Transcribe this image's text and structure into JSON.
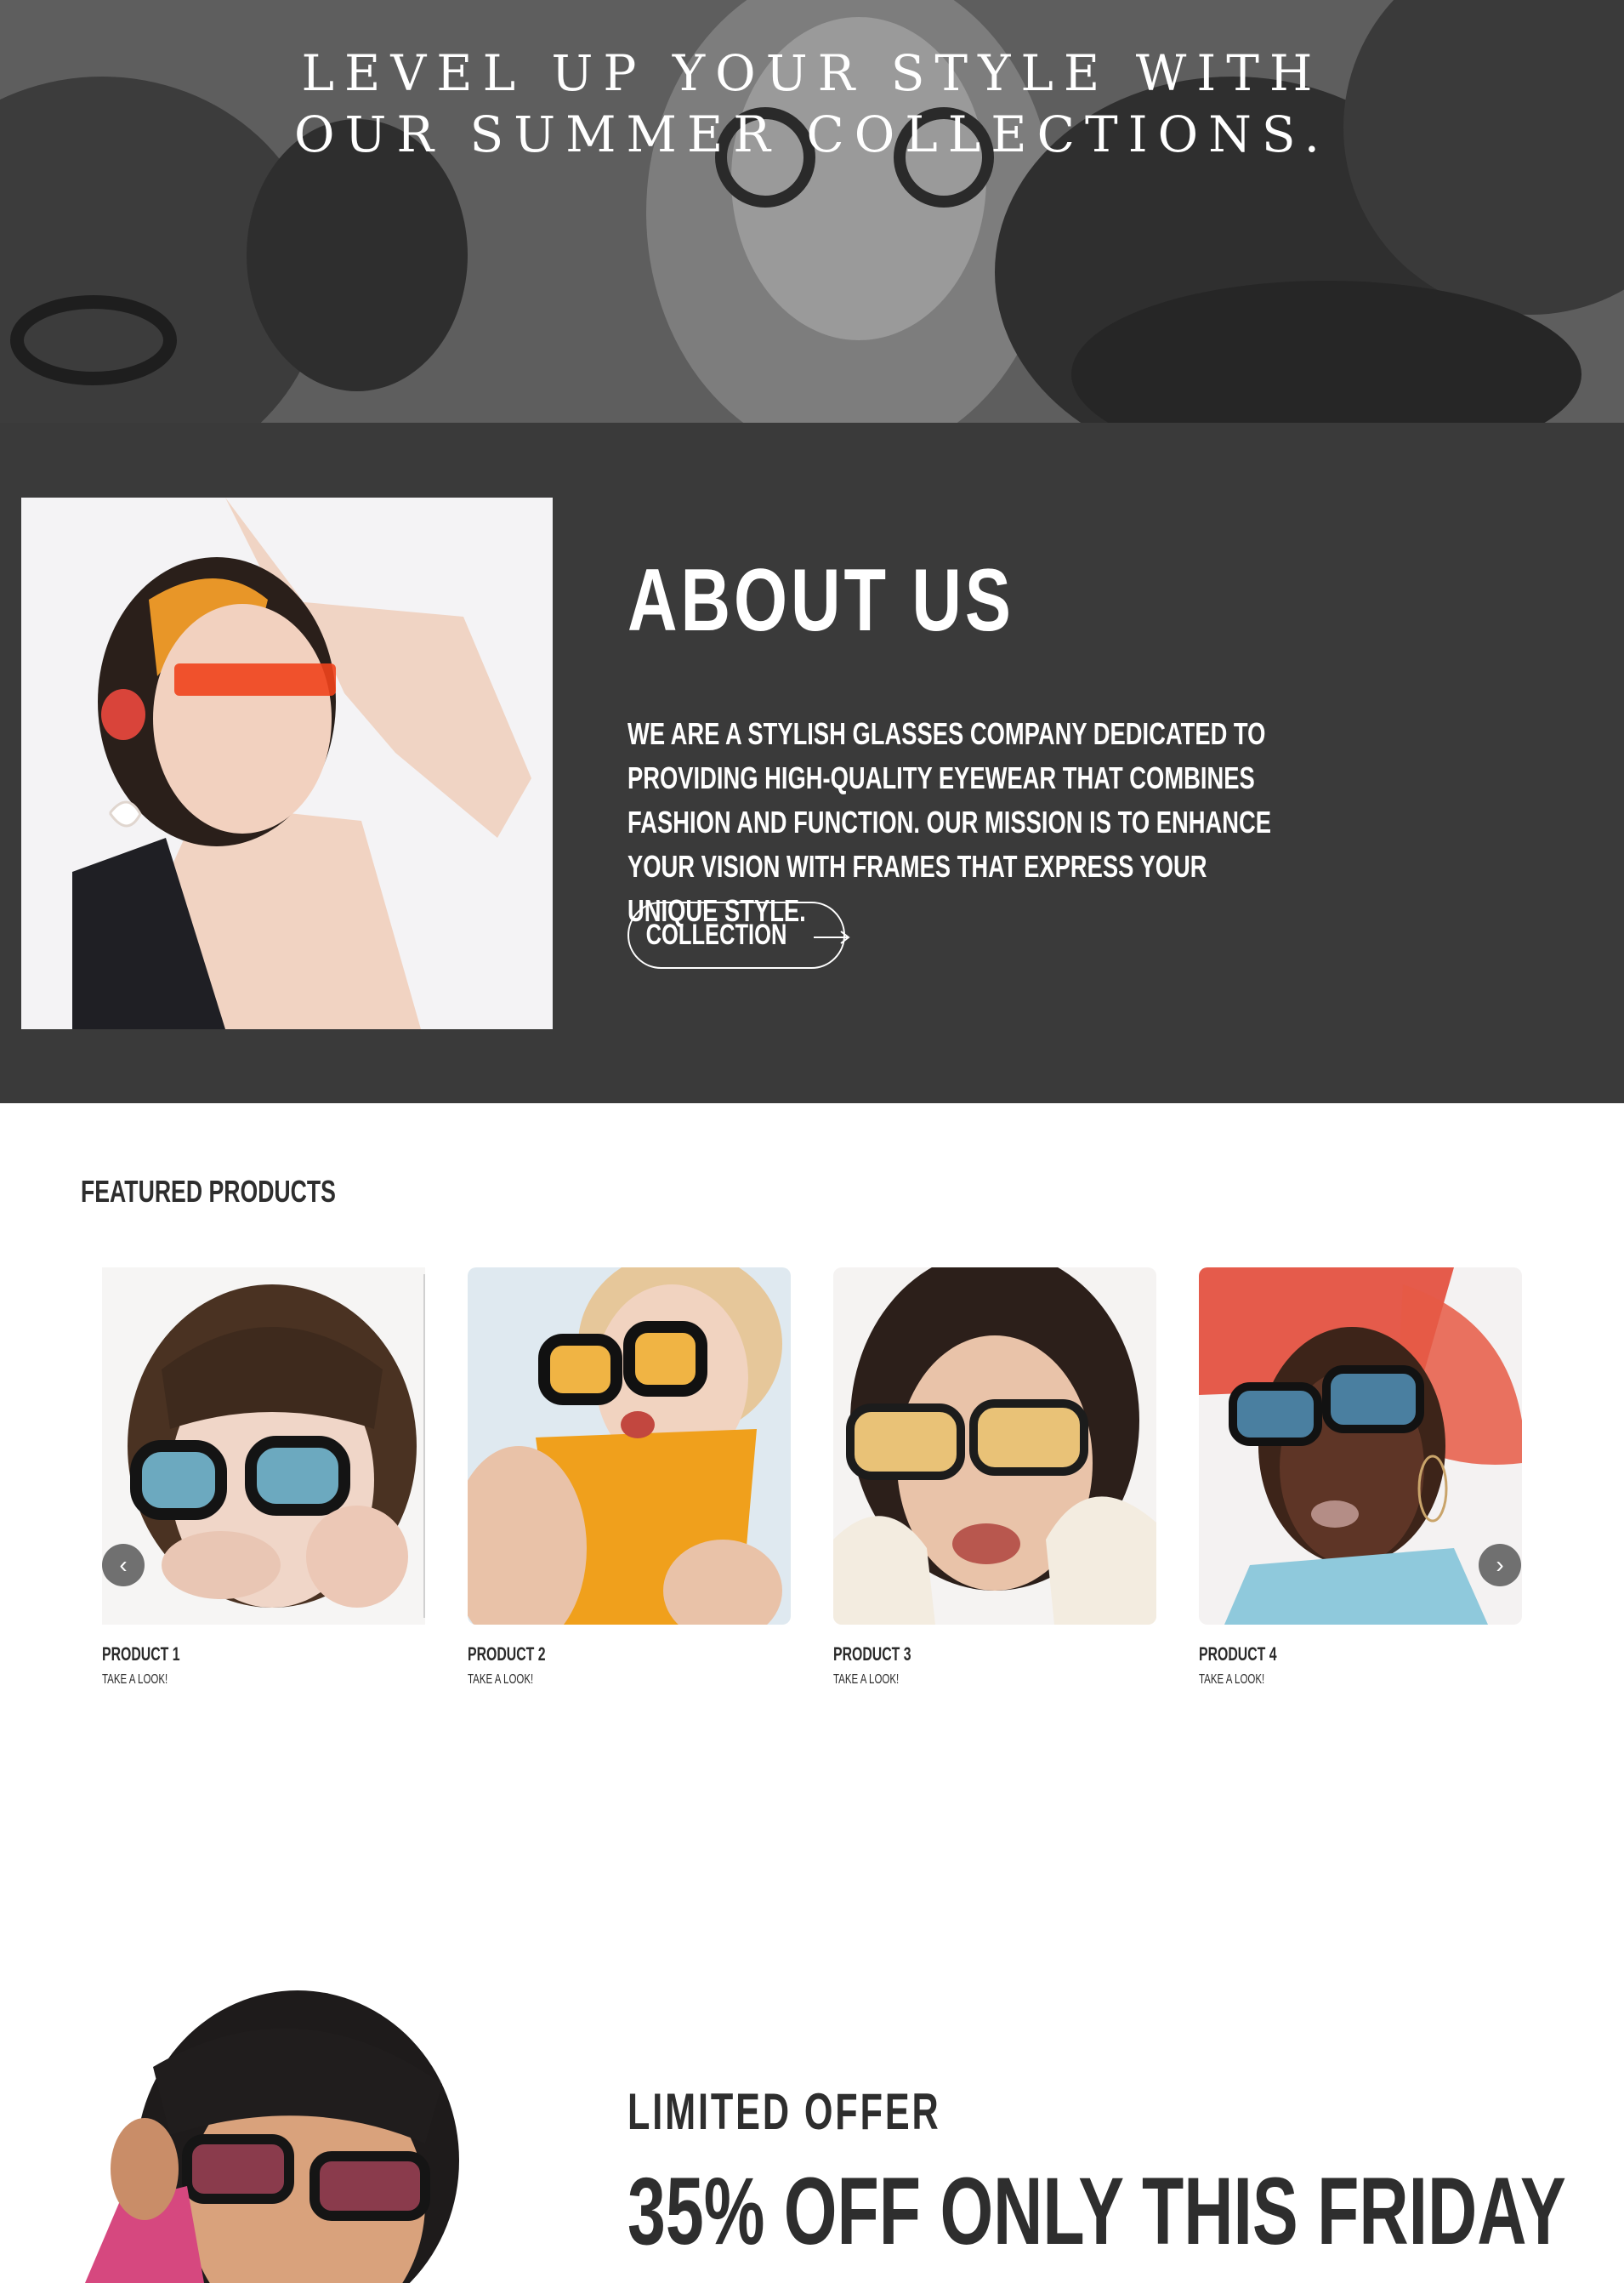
{
  "hero": {
    "line1": "LEVEL UP YOUR STYLE WITH",
    "line2": "OUR SUMMER COLLECTIONS."
  },
  "about": {
    "title": "ABOUT US",
    "text": "WE ARE A STYLISH GLASSES COMPANY DEDICATED TO PROVIDING HIGH-QUALITY EYEWEAR THAT COMBINES FASHION AND FUNCTION. OUR MISSION IS TO ENHANCE YOUR VISION WITH FRAMES THAT EXPRESS YOUR UNIQUE STYLE.",
    "button_label": "COLLECTION",
    "button_icon": "arrow-right-icon"
  },
  "featured": {
    "title": "FEATURED PRODUCTS",
    "products": [
      {
        "name": "PRODUCT 1",
        "sub": "TAKE A LOOK!"
      },
      {
        "name": "PRODUCT 2",
        "sub": "TAKE A LOOK!"
      },
      {
        "name": "PRODUCT 3",
        "sub": "TAKE A LOOK!"
      },
      {
        "name": "PRODUCT 4",
        "sub": "TAKE A LOOK!"
      }
    ],
    "prev_icon": "chevron-left-icon",
    "next_icon": "chevron-right-icon"
  },
  "offer": {
    "kicker": "LIMITED OFFER",
    "title": "35% OFF ONLY THIS FRIDAY"
  },
  "colors": {
    "about_bg": "#3a3a3a",
    "text_dark": "#2e2e2e",
    "nav_button": "#707070"
  }
}
